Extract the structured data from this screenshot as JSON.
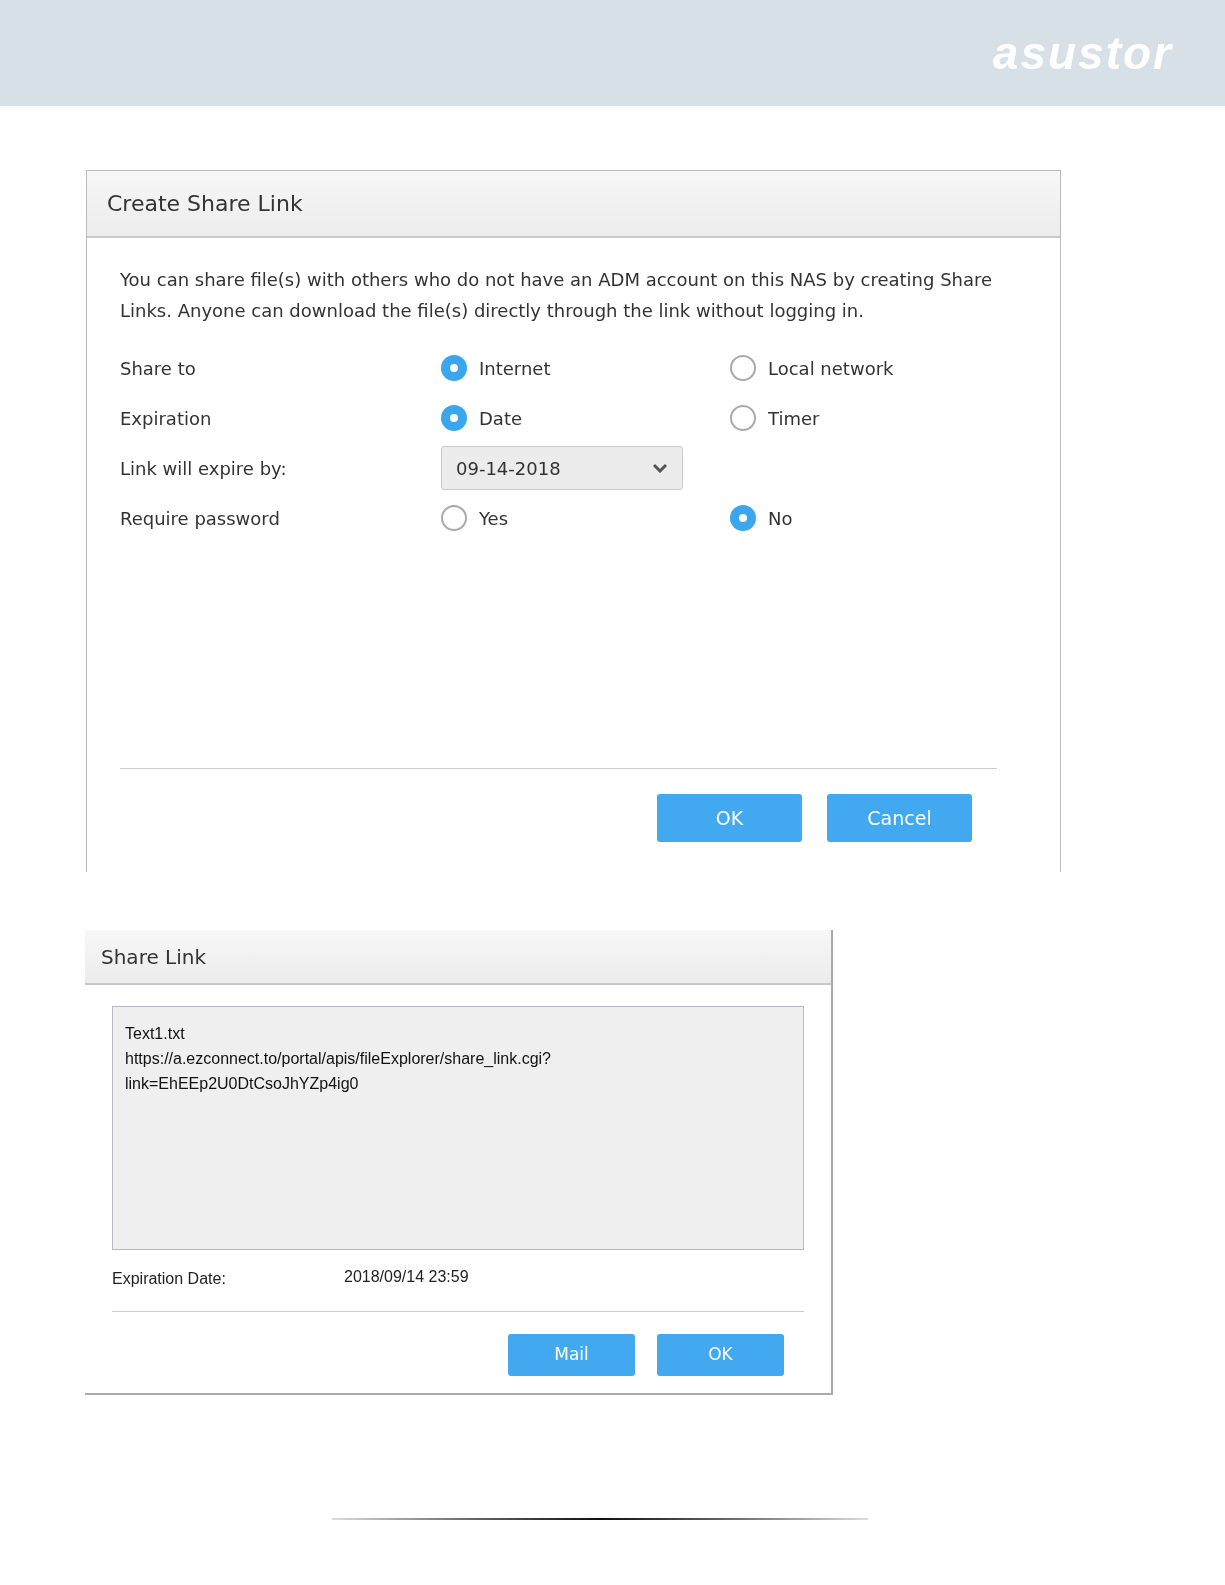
{
  "header": {
    "logo": "asustor"
  },
  "create_dialog": {
    "title": "Create Share Link",
    "description": "You can share file(s) with others who do not have an ADM account on this NAS by creating Share Links. Anyone can download the file(s) directly through the link without logging in.",
    "rows": [
      {
        "kind": "radio",
        "label": "Share to",
        "options": [
          {
            "label": "Internet",
            "selected": true
          },
          {
            "label": "Local network",
            "selected": false
          }
        ]
      },
      {
        "kind": "radio",
        "label": "Expiration",
        "options": [
          {
            "label": "Date",
            "selected": true
          },
          {
            "label": "Timer",
            "selected": false
          }
        ]
      },
      {
        "kind": "dropdown",
        "label": "Link will expire by:",
        "value": "09-14-2018"
      },
      {
        "kind": "radio",
        "label": "Require password",
        "options": [
          {
            "label": "Yes",
            "selected": false
          },
          {
            "label": "No",
            "selected": true
          }
        ]
      }
    ],
    "buttons": [
      "OK",
      "Cancel"
    ]
  },
  "share_dialog": {
    "title": "Share Link",
    "link_lines": [
      "Text1.txt",
      "https://a.ezconnect.to/portal/apis/fileExplorer/share_link.cgi?",
      "link=EhEEp2U0DtCsoJhYZp4ig0"
    ],
    "expiration_label": "Expiration Date:",
    "expiration_value": "2018/09/14 23:59",
    "buttons": [
      "Mail",
      "OK"
    ]
  }
}
